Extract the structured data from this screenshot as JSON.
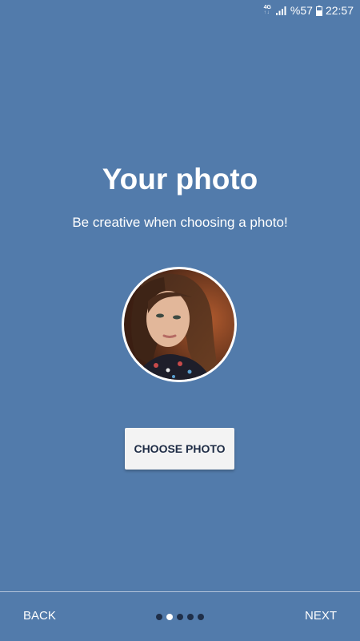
{
  "status_bar": {
    "network": "4G",
    "battery": "%57",
    "time": "22:57"
  },
  "onboarding": {
    "title": "Your photo",
    "subtitle": "Be creative when choosing a photo!",
    "choose_button": "CHOOSE PHOTO"
  },
  "footer": {
    "back": "BACK",
    "next": "NEXT",
    "page_count": 5,
    "active_page": 2
  },
  "colors": {
    "background": "#527bab",
    "button_bg": "#f3f3f3",
    "button_text": "#1d2b44",
    "dot_inactive": "#1f2f49",
    "dot_active": "#ffffff"
  }
}
